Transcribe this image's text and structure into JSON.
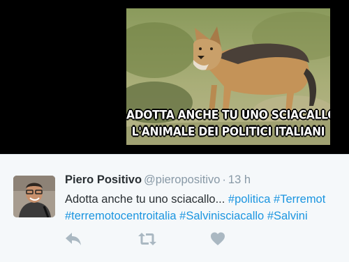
{
  "media": {
    "caption_line1": "ADOTTA ANCHE TU UNO SCIACALLO,",
    "caption_line2": "L'ANIMALE DEI POLITICI ITALIANI"
  },
  "tweet": {
    "author_name": "Piero Positivo",
    "author_handle": "@pieropositivo",
    "separator": "·",
    "time": "13 h",
    "text_prefix": "Adotta anche tu uno sciacallo... ",
    "hashtags_line1": [
      "#politica",
      "#Terremot"
    ],
    "hashtags_line2": [
      "#terremotocentroitalia",
      "#Salvinisciacallo",
      "#Salvini"
    ]
  },
  "actions": {
    "reply_icon": "reply-icon",
    "retweet_icon": "retweet-icon",
    "like_icon": "heart-icon"
  },
  "colors": {
    "hashtag": "#1b95e0",
    "action_icon": "#aab8c2",
    "tweet_background": "#f5f8fa",
    "text": "#292f33",
    "muted": "#8899a6"
  }
}
